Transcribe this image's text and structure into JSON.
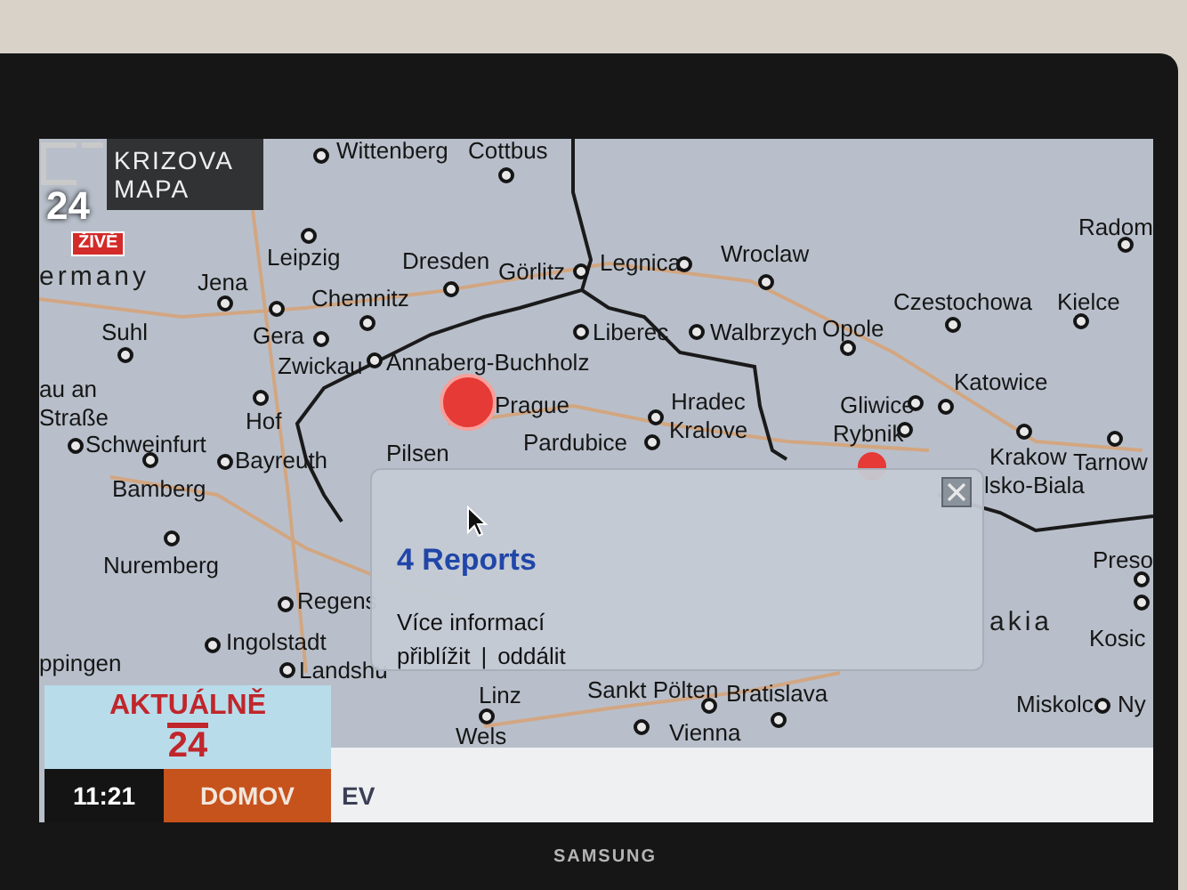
{
  "channel_logo": {
    "title_lines": [
      "KRIZOVA",
      "MAPA"
    ],
    "number": "24",
    "live_badge": "ŽIVĚ"
  },
  "map": {
    "places": [
      {
        "kind": "town",
        "name": "Wittenberg"
      },
      {
        "kind": "town",
        "name": "Cottbus"
      },
      {
        "kind": "town",
        "name": "Radom"
      },
      {
        "kind": "town",
        "name": "Leipzig"
      },
      {
        "kind": "town",
        "name": "Dresden"
      },
      {
        "kind": "town",
        "name": "Görlitz"
      },
      {
        "kind": "town",
        "name": "Legnica"
      },
      {
        "kind": "town",
        "name": "Wroclaw"
      },
      {
        "kind": "country",
        "name": "ermany"
      },
      {
        "kind": "town",
        "name": "Jena"
      },
      {
        "kind": "town",
        "name": "Chemnitz"
      },
      {
        "kind": "town",
        "name": "Czestochowa"
      },
      {
        "kind": "town",
        "name": "Kielce"
      },
      {
        "kind": "town",
        "name": "Suhl"
      },
      {
        "kind": "town",
        "name": "Gera"
      },
      {
        "kind": "town",
        "name": "Liberec"
      },
      {
        "kind": "town",
        "name": "Walbrzych"
      },
      {
        "kind": "town",
        "name": "Opole"
      },
      {
        "kind": "town",
        "name": "Zwickau"
      },
      {
        "kind": "town",
        "name": "Annaberg-Buchholz"
      },
      {
        "kind": "town",
        "name": "Katowice"
      },
      {
        "kind": "label",
        "name": "au an"
      },
      {
        "kind": "label",
        "name": "Straße"
      },
      {
        "kind": "label",
        "name": "Hradec"
      },
      {
        "kind": "town",
        "name": "Gliwice"
      },
      {
        "kind": "town",
        "name": "Kralove"
      },
      {
        "kind": "town",
        "name": "Hof"
      },
      {
        "kind": "label",
        "name": "Prague"
      },
      {
        "kind": "town",
        "name": "Pardubice"
      },
      {
        "kind": "town",
        "name": "Rybnik"
      },
      {
        "kind": "town",
        "name": "Krakow"
      },
      {
        "kind": "town",
        "name": "Tarnow"
      },
      {
        "kind": "town",
        "name": "Schweinfurt"
      },
      {
        "kind": "town",
        "name": "Bayreuth"
      },
      {
        "kind": "label",
        "name": "Pilsen"
      },
      {
        "kind": "label",
        "name": "lsko-Biala"
      },
      {
        "kind": "town",
        "name": "Bamberg"
      },
      {
        "kind": "town",
        "name": "Nuremberg"
      },
      {
        "kind": "town",
        "name": "Regens"
      },
      {
        "kind": "label",
        "name": "ppingen"
      },
      {
        "kind": "town",
        "name": "Ingolstadt"
      },
      {
        "kind": "town",
        "name": "Landshu"
      },
      {
        "kind": "label",
        "name": "Linz"
      },
      {
        "kind": "town",
        "name": "Wels"
      },
      {
        "kind": "town",
        "name": "Sankt Pölten"
      },
      {
        "kind": "town",
        "name": "Bratislava"
      },
      {
        "kind": "town",
        "name": "Vienna"
      },
      {
        "kind": "country",
        "name": "akia"
      },
      {
        "kind": "town",
        "name": "Preso"
      },
      {
        "kind": "town",
        "name": "Kosic"
      },
      {
        "kind": "town",
        "name": "Miskolc"
      },
      {
        "kind": "label",
        "name": "Ny"
      }
    ]
  },
  "popup": {
    "title": "4 Reports",
    "more_info_link": "Více informací",
    "zoom_in_link": "přiblížit",
    "separator": "|",
    "zoom_out_link": "oddálit"
  },
  "ticker": {
    "program_lines": [
      "AKTUÁLNĚ",
      "24"
    ],
    "time": "11:21",
    "section": "DOMOV",
    "headline": "EV"
  },
  "tv": {
    "brand": "SAMSUNG"
  }
}
